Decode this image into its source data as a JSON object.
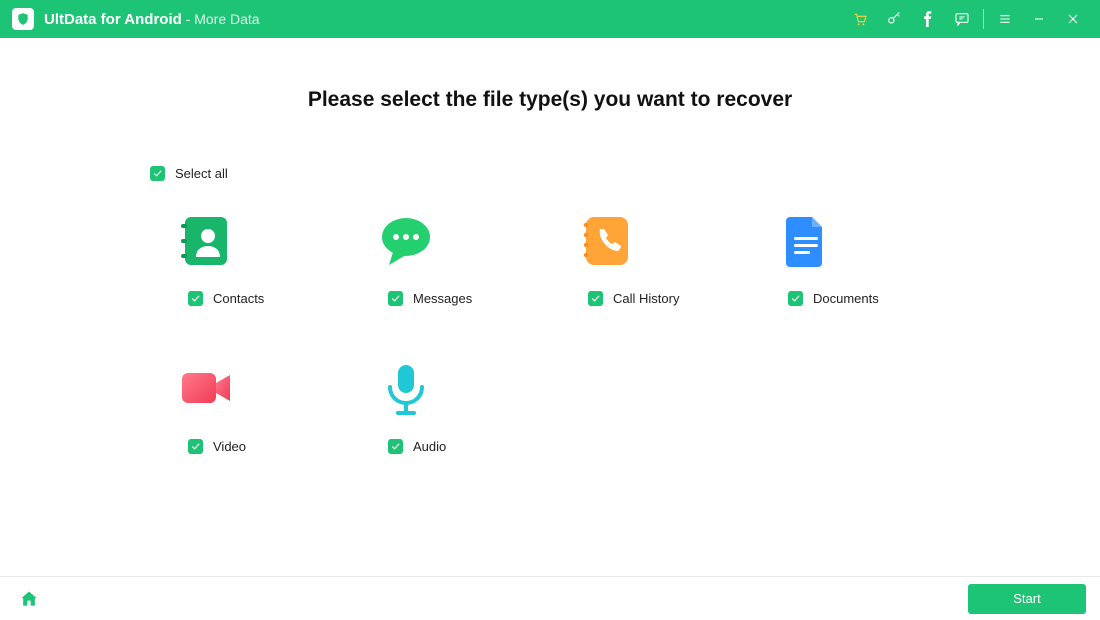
{
  "titlebar": {
    "app_name": "UltData for Android",
    "separator": " - ",
    "section": "More Data"
  },
  "heading": "Please select the file type(s) you want to recover",
  "select_all": {
    "label": "Select all",
    "checked": true
  },
  "tiles": [
    {
      "label": "Contacts",
      "checked": true,
      "icon": "contacts-icon"
    },
    {
      "label": "Messages",
      "checked": true,
      "icon": "messages-icon"
    },
    {
      "label": "Call History",
      "checked": true,
      "icon": "call-history-icon"
    },
    {
      "label": "Documents",
      "checked": true,
      "icon": "documents-icon"
    },
    {
      "label": "Video",
      "checked": true,
      "icon": "video-icon"
    },
    {
      "label": "Audio",
      "checked": true,
      "icon": "audio-icon"
    }
  ],
  "footer": {
    "start_label": "Start"
  },
  "colors": {
    "accent": "#1dc475"
  }
}
